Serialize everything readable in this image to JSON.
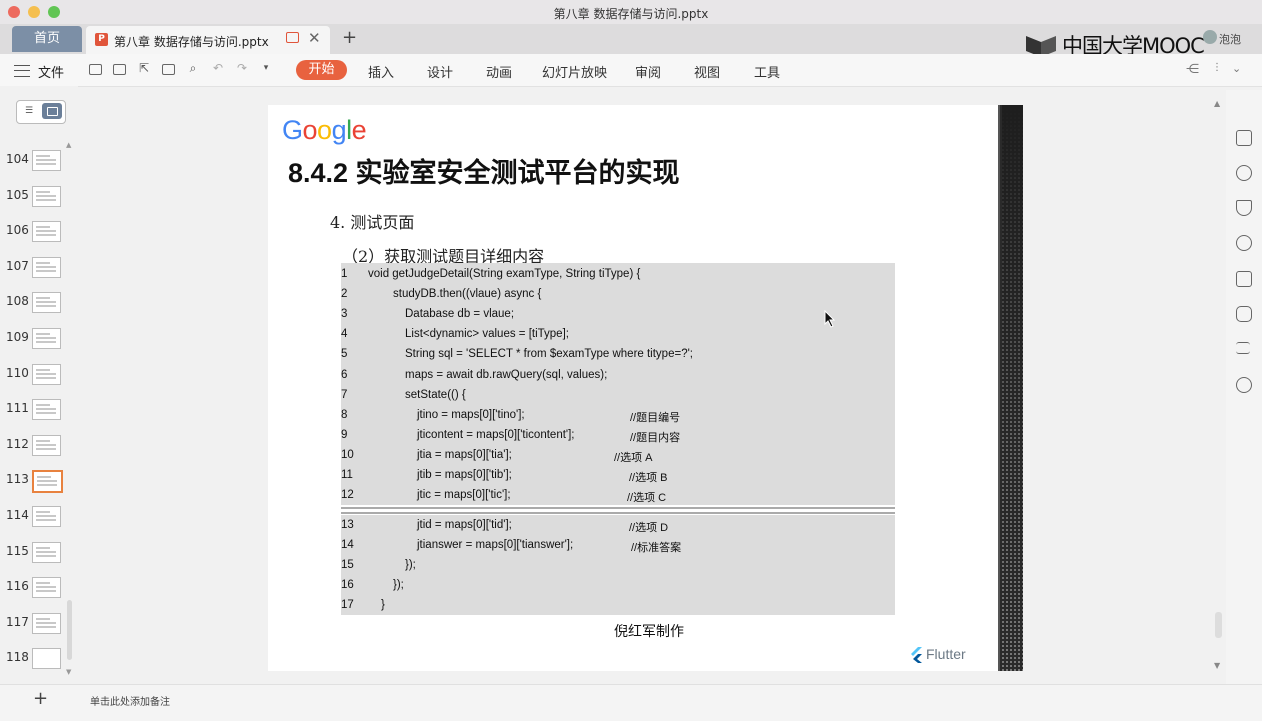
{
  "window": {
    "title": "第八章 数据存储与访问.pptx"
  },
  "tabs": {
    "home_label": "首页",
    "doc_label": "第八章 数据存储与访问.pptx"
  },
  "branding": {
    "mooc_logo_text": "中国大学MOOC",
    "username": "泡泡"
  },
  "toolbar": {
    "file_label": "文件",
    "ribbon_tabs": [
      "开始",
      "插入",
      "设计",
      "动画",
      "幻灯片放映",
      "审阅",
      "视图",
      "工具"
    ],
    "active_tab": "开始",
    "accent_color": "#e8623f"
  },
  "slides_panel": {
    "numbers": [
      "104",
      "105",
      "106",
      "107",
      "108",
      "109",
      "110",
      "111",
      "112",
      "113",
      "114",
      "115",
      "116",
      "117",
      "118"
    ],
    "selected": "113"
  },
  "notes_placeholder": "单击此处添加备注",
  "slide": {
    "logo": "Google",
    "title": "8.4.2 实验室安全测试平台的实现",
    "subheading1": "4.  测试页面",
    "subheading2": "（2）获取测试题目详细内容",
    "code_lines": [
      {
        "n": "1",
        "code": "void getJudgeDetail(String examType, String tiType) {",
        "comment": ""
      },
      {
        "n": "2",
        "code": "studyDB.then((vlaue) async {",
        "comment": ""
      },
      {
        "n": "3",
        "code": "Database db = vlaue;",
        "comment": ""
      },
      {
        "n": "4",
        "code": "List<dynamic> values = [tiType];",
        "comment": ""
      },
      {
        "n": "5",
        "code": "String sql = 'SELECT * from $examType where titype=?';",
        "comment": ""
      },
      {
        "n": "6",
        "code": "maps = await db.rawQuery(sql, values);",
        "comment": ""
      },
      {
        "n": "7",
        "code": "setState(() {",
        "comment": ""
      },
      {
        "n": "8",
        "code": "jtino = maps[0]['tino'];",
        "comment": "//题目编号"
      },
      {
        "n": "9",
        "code": "jticontent = maps[0]['ticontent'];",
        "comment": "//题目内容"
      },
      {
        "n": "10",
        "code": "jtia = maps[0]['tia'];",
        "comment": "//选项 A"
      },
      {
        "n": "11",
        "code": "jtib = maps[0]['tib'];",
        "comment": "//选项 B"
      },
      {
        "n": "12",
        "code": "jtic = maps[0]['tic'];",
        "comment": "//选项 C"
      },
      {
        "n": "13",
        "code": "jtid = maps[0]['tid'];",
        "comment": "//选项 D"
      },
      {
        "n": "14",
        "code": "jtianswer = maps[0]['tianswer'];",
        "comment": "//标准答案"
      },
      {
        "n": "15",
        "code": "});",
        "comment": ""
      },
      {
        "n": "16",
        "code": "});",
        "comment": ""
      },
      {
        "n": "17",
        "code": "}",
        "comment": ""
      }
    ],
    "author": "倪红军制作",
    "footer_logo": "Flutter"
  }
}
